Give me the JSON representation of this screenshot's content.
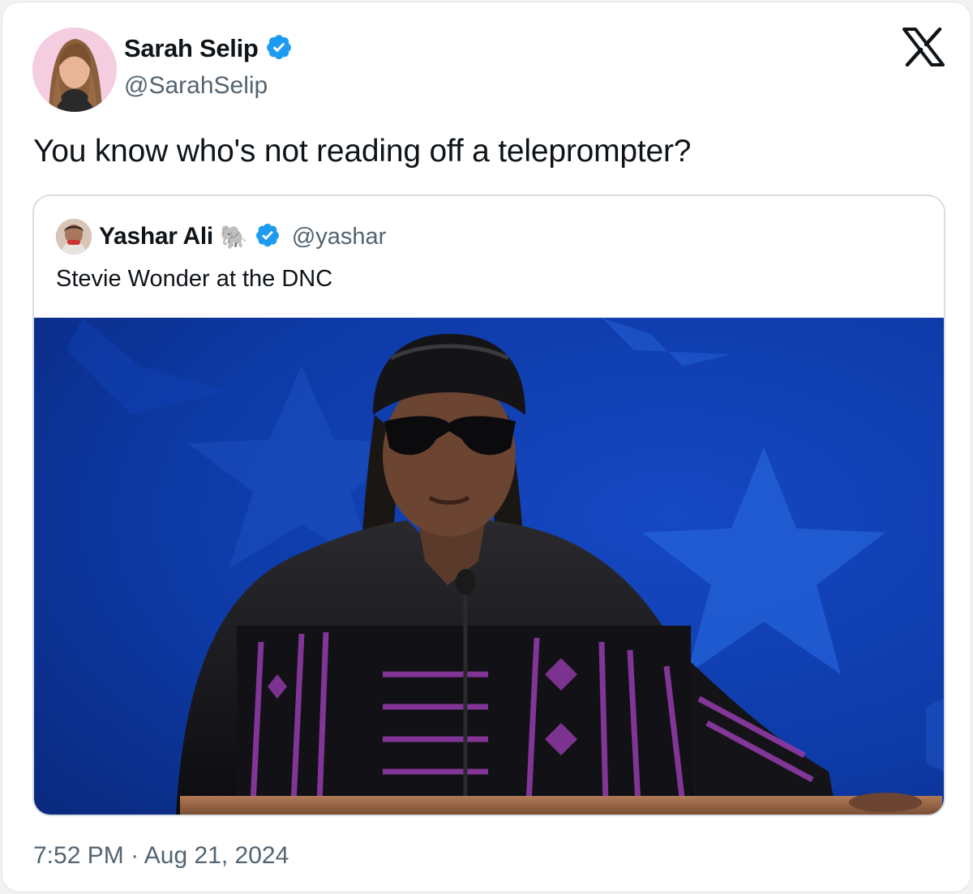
{
  "author": {
    "name": "Sarah Selip",
    "handle": "@SarahSelip",
    "verified": true
  },
  "tweet": {
    "text": "You know who's not reading off a teleprompter?",
    "time": "7:52 PM",
    "separator": "·",
    "date": "Aug 21, 2024"
  },
  "quoted_tweet": {
    "name": "Yashar Ali",
    "emoji": "🐘",
    "handle": "@yashar",
    "verified": true,
    "text": "Stevie Wonder at the DNC",
    "media_icon": "photo"
  },
  "icons": {
    "brand": "x-logo",
    "badge": "verified-badge-icon"
  },
  "colors": {
    "verified": "#1d9bf0",
    "text": "#0f1419",
    "muted": "#536471",
    "stage_blue": "#0d3aa6",
    "stripe_purple": "#8f3aa6"
  }
}
